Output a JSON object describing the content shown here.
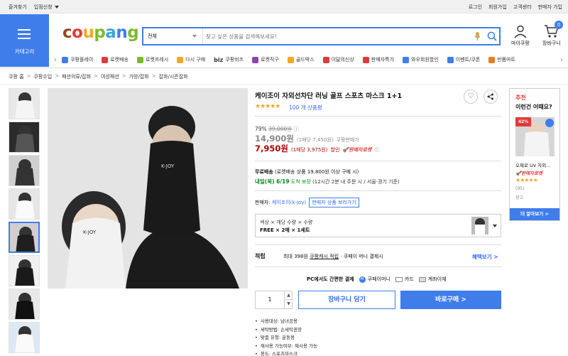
{
  "topbar": {
    "left": [
      "즐겨찾기",
      "입점신청"
    ],
    "right": [
      "로그인",
      "회원가입",
      "고객센터",
      "판매자 가입"
    ]
  },
  "header": {
    "category_label": "카테고리",
    "logo_letters": [
      "c",
      "o",
      "u",
      "p",
      "a",
      "n",
      "g"
    ],
    "logo_colors": [
      "#8c4a1e",
      "#e03a3a",
      "#f5a623",
      "#7cbb2a",
      "#34a8e0",
      "#3f7dea",
      "#7cbb2a"
    ],
    "search_category": "전체",
    "search_placeholder": "찾고 싶은 상품을 검색해보세요!",
    "mycoupang": "마이쿠팡",
    "cart": "장바구니",
    "cart_count": "0"
  },
  "shortcuts": [
    {
      "label": "쿠팡플레이",
      "color": "#3f7dea"
    },
    {
      "label": "로켓배송",
      "color": "#e03a3a"
    },
    {
      "label": "로켓프레시",
      "color": "#7cbb2a"
    },
    {
      "label": "다시 구매",
      "color": "#f5a623"
    },
    {
      "label": "쿠팡비즈",
      "color": "#444444",
      "prefix": "biz"
    },
    {
      "label": "로켓직구",
      "color": "#8e44ad"
    },
    {
      "label": "골드박스",
      "color": "#f5a623"
    },
    {
      "label": "이달의신상",
      "color": "#e03a3a"
    },
    {
      "label": "판매자특가",
      "color": "#e03a3a"
    },
    {
      "label": "와우회원할인",
      "color": "#3f7dea"
    },
    {
      "label": "이벤트/쿠폰",
      "color": "#3f7dea"
    },
    {
      "label": "반품마트",
      "color": "#e67e22"
    }
  ],
  "breadcrumb": [
    "쿠팡 홈",
    "쿠팡수입",
    "패션의류/잡화",
    "여성패션",
    "가방/잡화",
    "잡화/시즌잡화"
  ],
  "product": {
    "title": "케이조이 자외선차단 러닝 골프 스포츠 마스크 1+1",
    "stars": "★★★★★",
    "reviews": "100 개 상품평",
    "discount_rate": "79%",
    "original_price": "39,000원",
    "coupang_price": "14,900원",
    "coupang_unit": "(1매당 7,450원)",
    "coupang_label": "쿠팡판매가",
    "sale_price": "7,950원",
    "sale_unit": "(1매당 3,975원)",
    "sale_label": "할인",
    "rocket_tag": "🚀판매자로켓",
    "shipping_title": "무료배송",
    "shipping_cond": "(로켓배송 상품 19,800원 이상 구매 시)",
    "arrival": "내일(목) 6/19",
    "arrival_guarantee": "도착 보장",
    "arrival_cond": "(12시간 2분 내 주문 시 / 서울·경기 기준)",
    "seller_label": "판매자:",
    "seller_name": "케이조이(k-joy)",
    "seller_more": "판매자 상품 보러가기",
    "option_line1": "색상 × 개당 수량 × 수량",
    "option_line2": "FREE × 2매 × 1세트",
    "earn_label": "적립",
    "earn_text": "최대 398원",
    "earn_link": "쿠팡캐시 적립",
    "earn_suffix": "· 쿠페이 머니 결제시",
    "benefit": "혜택보기 >",
    "pay_title": "PC에서도 간편한 결제",
    "pay_money": "쿠페이머니",
    "pay_card": "카드",
    "pay_account": "계좌이체",
    "quantity": "1",
    "cart_btn": "장바구니 담기",
    "buy_btn": "바로구매 >",
    "bullets": [
      "사용대상: 남녀공용",
      "세탁방법: 손세탁권장",
      "맞춤 유형: 운동용",
      "재사용 가능여부: 재사용 가능",
      "용도: 스포츠마스크"
    ]
  },
  "reco": {
    "label1": "추천",
    "label2": "이런건 어때요?",
    "discount": "42%",
    "name": "오제로 UV 자외...",
    "rocket": "🚀판매자로켓",
    "stars": "★★★★★",
    "count": "(95)",
    "ad": "광고",
    "more": "더 알아보기 >"
  }
}
